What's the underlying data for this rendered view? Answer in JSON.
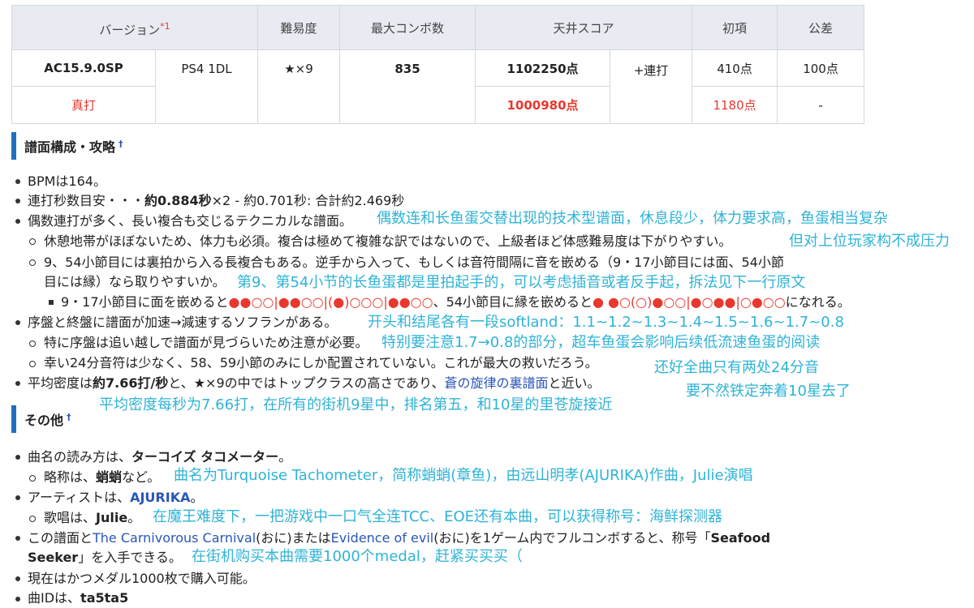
{
  "table": {
    "headers": {
      "version": "バージョン",
      "version_note": "*1",
      "difficulty": "難易度",
      "max_combo": "最大コンボ数",
      "ceiling_score": "天井スコア",
      "initial": "初項",
      "diff": "公差"
    },
    "row1": {
      "version": "AC15.9.0SP",
      "platform": "PS4 1DL",
      "difficulty": "★×9",
      "max_combo": "835",
      "score": "1102250点",
      "renda": "+連打",
      "initial": "410点",
      "diff": "100点"
    },
    "row2": {
      "version": "真打",
      "score": "1000980点",
      "initial": "1180点",
      "diff": "-"
    }
  },
  "section1": {
    "title": "譜面構成・攻略",
    "dagger": "†",
    "l1": "BPMは164。",
    "l2a": "連打秒数目安・・・",
    "l2b": "約0.884秒",
    "l2c": "×2 - 約0.701秒:  合計約2.469秒",
    "l3": "偶数連打が多く、長い複合も交じるテクニカルな譜面。",
    "l3n": "偶数连和长鱼蛋交替出现的技术型谱面，休息段少，体力要求高，鱼蛋相当复杂",
    "l4": "休憩地帯がほぼないため、体力も必須。複合は極めて複雑な訳ではないので、上級者ほど体感難易度は下がりやすい。",
    "l4n": "但对上位玩家构不成压力",
    "l5": "9、54小節目には裏拍から入る長複合もある。逆手から入って、もしくは音符間隔に音を嵌める（9・17小節目には面、54小節",
    "l6": "目には縁）なら取りやすいか。",
    "l6n": "第9、第54小节的长鱼蛋都是里拍起手的，可以考虑插音或者反手起，拆法见下一行原文",
    "l7a": "9・17小節目に面を嵌めると",
    "l7b": "●●○○|●●○○|(●)○○○|●●○○",
    "l7c": "、54小節目に縁を嵌めると",
    "l7d": "● ●○(○)●○○|●○●●|○●○○",
    "l7e": "になれる。",
    "l8": "序盤と終盤に譜面が加速→減速するソフランがある。",
    "l8n": "开头和结尾各有一段softland：1.1~1.2~1.3~1.4~1.5~1.6~1.7~0.8",
    "l9": "特に序盤は追い越しで譜面が見づらいため注意が必要。",
    "l9n": "特别要注意1.7→0.8的部分，超车鱼蛋会影响后续低流速鱼蛋的阅读",
    "l10": "幸い24分音符は少なく、58、59小節のみにしか配置されていない。これが最大の救いだろう。",
    "l10n": "还好全曲只有两处24分音",
    "l11a": "平均密度は",
    "l11b": "約7.66打/秒",
    "l11c": "と、★×9の中ではトップクラスの高さであり、",
    "l11d": "蒼の旋律の裏譜面",
    "l11e": "と近い。",
    "l11n": "要不然铁定奔着10星去了",
    "l12n": "平均密度每秒为7.66打，在所有的街机9星中，排名第五，和10星的里苍旋接近"
  },
  "section2": {
    "title": "その他",
    "dagger": "†",
    "m1a": "曲名の読み方は、",
    "m1b": "ターコイズ タコメーター",
    "m1c": "。",
    "m2a": "略称は、",
    "m2b": "蛸蛸",
    "m2c": "など。",
    "m2n": "曲名为Turquoise Tachometer，简称蛸蛸(章鱼)，由远山明孝(AJURIKA)作曲，Julie演唱",
    "m3a": "アーティストは、",
    "m3b": "AJURIKA",
    "m3c": "。",
    "m4a": "歌唱は、",
    "m4b": "Julie",
    "m4c": "。",
    "m4n": "在魔王难度下，一把游戏中一口气全连TCC、EOE还有本曲，可以获得称号：海鲜探测器",
    "m5a": "この譜面と",
    "m5b": "The Carnivorous Carnival",
    "m5c": "(おに)または",
    "m5d": "Evidence of evil",
    "m5e": "(おに)を1ゲーム内でフルコンボすると、称号「",
    "m5f": "Seafood",
    "m6a": "Seeker",
    "m6b": "」を入手できる。",
    "m6n": "在街机购买本曲需要1000个medal，赶紧买买买（",
    "m7": "現在はかつメダル1000枚で購入可能。",
    "m8a": "曲IDは、",
    "m8b": "ta5ta5"
  }
}
